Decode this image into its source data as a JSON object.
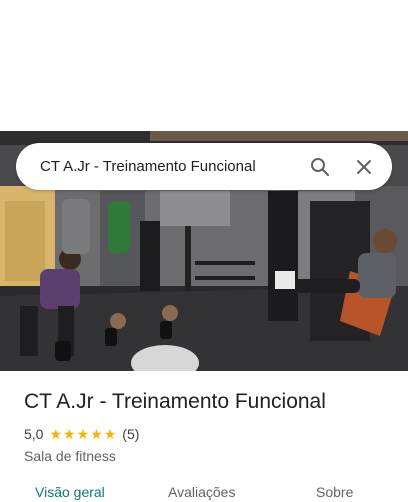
{
  "search": {
    "query": "CT A.Jr - Treinamento Funcional"
  },
  "place": {
    "title": "CT A.Jr - Treinamento Funcional",
    "rating": "5,0",
    "stars": 5,
    "review_count": "(5)",
    "category": "Sala de fitness"
  },
  "tabs": [
    {
      "label": "Visão geral",
      "active": true
    },
    {
      "label": "Avaliações",
      "active": false
    },
    {
      "label": "Sobre",
      "active": false
    }
  ],
  "colors": {
    "accent": "#0b7b6b",
    "star": "#f6b400"
  },
  "icons": [
    "search-icon",
    "close-icon"
  ]
}
